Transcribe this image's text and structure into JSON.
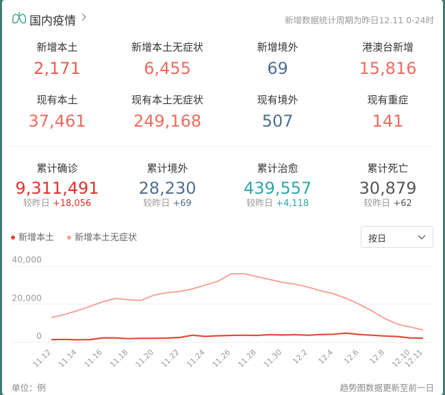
{
  "header": {
    "title": "国内疫情",
    "note": "新增数据统计周期为昨日12.11 0-24时"
  },
  "rows": [
    [
      {
        "label": "新增本土",
        "value": "2,171",
        "color": "#ef5b4f"
      },
      {
        "label": "新增本土无症状",
        "value": "6,455",
        "color": "#ef6b5f"
      },
      {
        "label": "新增境外",
        "value": "69",
        "color": "#4f6f8f"
      },
      {
        "label": "港澳台新增",
        "value": "15,816",
        "color": "#ef6b5f"
      }
    ],
    [
      {
        "label": "现有本土",
        "value": "37,461",
        "color": "#ef6b5f"
      },
      {
        "label": "现有本土无症状",
        "value": "249,168",
        "color": "#ef6b5f"
      },
      {
        "label": "现有境外",
        "value": "507",
        "color": "#4f6f8f"
      },
      {
        "label": "现有重症",
        "value": "141",
        "color": "#ef6b5f"
      }
    ]
  ],
  "cumulative": [
    {
      "label": "累计确诊",
      "value": "9,311,491",
      "delta_prefix": "较昨日",
      "delta": "+18,056",
      "color": "#e0312a",
      "delta_color": "#e0312a"
    },
    {
      "label": "累计境外",
      "value": "28,230",
      "delta_prefix": "较昨日",
      "delta": "+69",
      "color": "#4f6f8f",
      "delta_color": "#4f6f8f"
    },
    {
      "label": "累计治愈",
      "value": "439,557",
      "delta_prefix": "较昨日",
      "delta": "+4,118",
      "color": "#2ea7a7",
      "delta_color": "#2ea7a7"
    },
    {
      "label": "累计死亡",
      "value": "30,879",
      "delta_prefix": "较昨日",
      "delta": "+62",
      "color": "#555555",
      "delta_color": "#555555"
    }
  ],
  "legend": {
    "items": [
      {
        "label": "新增本土",
        "color": "#e04a37"
      },
      {
        "label": "新增本土无症状",
        "color": "#f6a496"
      }
    ]
  },
  "period_select": {
    "value": "按日"
  },
  "chart_data": {
    "type": "line",
    "x": [
      "11.12",
      "11.13",
      "11.14",
      "11.15",
      "11.16",
      "11.17",
      "11.18",
      "11.19",
      "11.20",
      "11.21",
      "11.22",
      "11.23",
      "11.24",
      "11.25",
      "11.26",
      "11.27",
      "11.28",
      "11.29",
      "11.30",
      "12.1",
      "12.2",
      "12.3",
      "12.4",
      "12.5",
      "12.6",
      "12.7",
      "12.8",
      "12.9",
      "12.10",
      "12.11"
    ],
    "x_tick_labels": [
      "11.12",
      "11.14",
      "11.16",
      "11.18",
      "11.20",
      "11.22",
      "11.24",
      "11.26",
      "11.28",
      "11.30",
      "12.2",
      "12.4",
      "12.6",
      "12.8",
      "12.10",
      "12.11"
    ],
    "y_ticks": [
      "0",
      "20,000",
      "40,000"
    ],
    "ylim": [
      0,
      42000
    ],
    "grid": "horizontal",
    "series": [
      {
        "name": "新增本土",
        "color": "#e04a37",
        "values": [
          1400,
          1500,
          1300,
          1400,
          2300,
          2300,
          1900,
          2100,
          2100,
          2200,
          2500,
          3700,
          3100,
          3400,
          3600,
          3700,
          3600,
          4000,
          3800,
          4000,
          3700,
          4100,
          4200,
          4800,
          4100,
          3700,
          3300,
          3000,
          2300,
          2171
        ]
      },
      {
        "name": "新增本土无症状",
        "color": "#f6a496",
        "values": [
          13000,
          14500,
          16500,
          18800,
          21200,
          23000,
          22300,
          22000,
          24700,
          26000,
          26600,
          28000,
          30000,
          32000,
          35800,
          36000,
          34500,
          33000,
          31500,
          30500,
          29000,
          27000,
          25500,
          23000,
          20000,
          16500,
          12500,
          9500,
          8000,
          6455
        ]
      }
    ]
  },
  "footer": {
    "unit": "单位：例",
    "note": "趋势图数据更新至前一日"
  }
}
